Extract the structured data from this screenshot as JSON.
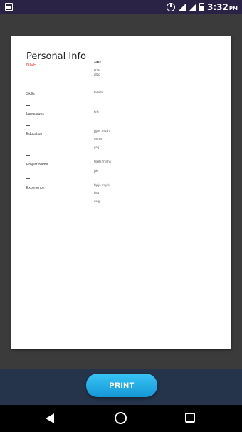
{
  "status_bar": {
    "time": "3:32",
    "ampm": "PM",
    "icons": [
      "app-icon",
      "alarm-icon",
      "signal-icon",
      "signal-icon",
      "battery-icon"
    ]
  },
  "document": {
    "title": "Personal Info",
    "name": "NIVE",
    "right_header": "adsc",
    "right_header_lines": [
      "tzzs",
      "dfzc"
    ],
    "sections": [
      {
        "label": "Skills",
        "values": [
          "fwbsfn"
        ]
      },
      {
        "label": "Languages",
        "values": [
          "fsfs"
        ]
      },
      {
        "label": "Education",
        "values": [
          "jlgus Xszth",
          "cscvs",
          "yarj"
        ]
      },
      {
        "label": "Project Name",
        "values": [
          "fskrls Yxyhs",
          "jsk"
        ]
      },
      {
        "label": "Experience",
        "values": [
          "fqdjs Ysyfs",
          "hsu",
          "ssgy"
        ]
      }
    ]
  },
  "actions": {
    "print_label": "PRINT"
  },
  "nav": [
    "back-icon",
    "home-icon",
    "recents-icon"
  ],
  "colors": {
    "status_bar": "#2b2346",
    "background": "#3b3b3b",
    "bottom_panel": "#25344a",
    "button": "#1fa8e6",
    "name_accent": "#e53935"
  }
}
